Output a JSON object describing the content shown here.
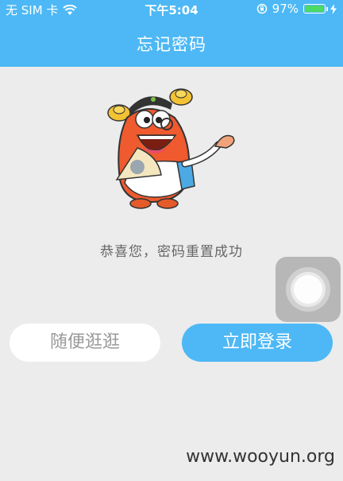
{
  "status_bar": {
    "carrier": "无 SIM 卡",
    "time": "下午5:04",
    "battery_percent": "97%",
    "battery_level": 0.97
  },
  "header": {
    "title": "忘记密码"
  },
  "main": {
    "message": "恭喜您，密码重置成功",
    "browse_label": "随便逛逛",
    "login_label": "立即登录"
  },
  "watermark": "www.wooyun.org",
  "colors": {
    "header_bg": "#4db8f5",
    "page_bg": "#ececec",
    "primary_button": "#4db8f5"
  }
}
